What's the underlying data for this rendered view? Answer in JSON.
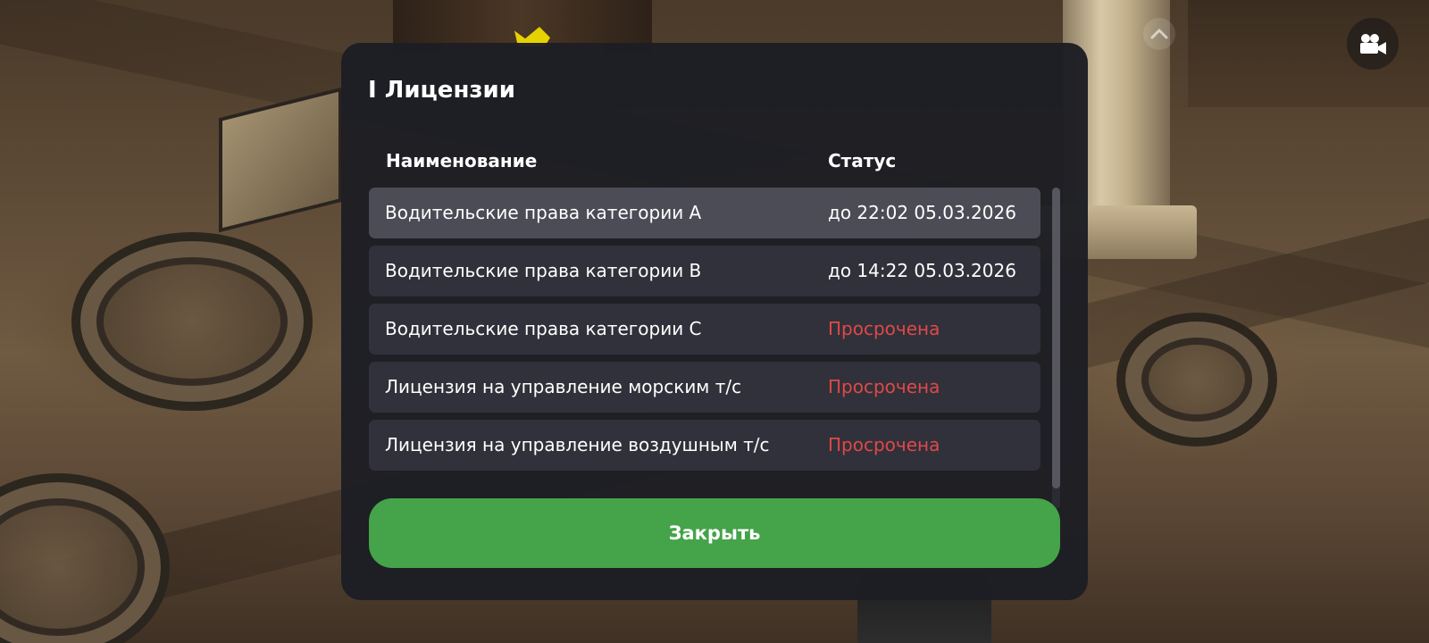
{
  "modal": {
    "title": "I Лицензии",
    "columns": {
      "name": "Наименование",
      "status": "Статус"
    },
    "rows": [
      {
        "name": "Водительские права категории A",
        "status": "до 22:02 05.03.2026",
        "expired": false,
        "selected": true
      },
      {
        "name": "Водительские права категории B",
        "status": "до 14:22 05.03.2026",
        "expired": false,
        "selected": false
      },
      {
        "name": "Водительские права категории C",
        "status": "Просрочена",
        "expired": true,
        "selected": false
      },
      {
        "name": "Лицензия на управление морским т/с",
        "status": "Просрочена",
        "expired": true,
        "selected": false
      },
      {
        "name": "Лицензия на управление воздушным т/с",
        "status": "Просрочена",
        "expired": true,
        "selected": false
      }
    ],
    "scroll_position": 0,
    "close_label": "Закрыть"
  },
  "hud": {
    "top_icon": "chevron-up-icon",
    "camera_icon": "video-camera-icon"
  },
  "colors": {
    "modal_bg": "#1d1e24",
    "row_bg": "#30313a",
    "row_selected_bg": "#4b4c56",
    "expired_text": "#e04848",
    "close_button": "#45a34a"
  }
}
